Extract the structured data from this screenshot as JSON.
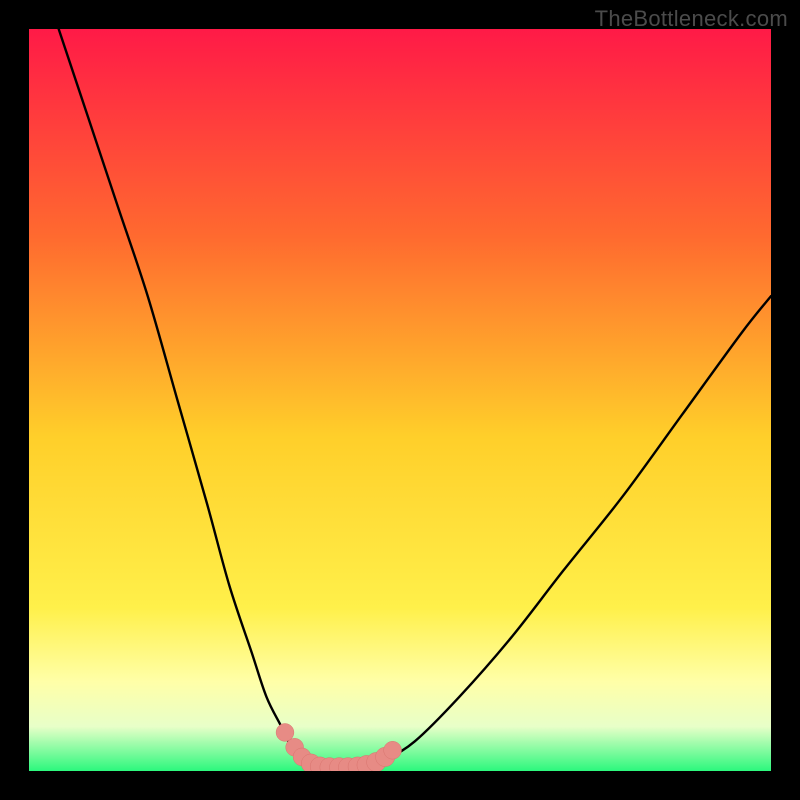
{
  "watermark": "TheBottleneck.com",
  "colors": {
    "frame": "#000000",
    "grad_top": "#ff1a47",
    "grad_mid1": "#ff8a2a",
    "grad_mid2": "#ffe92e",
    "grad_mid3": "#fffd8a",
    "grad_bottom": "#2cf87d",
    "curve": "#000000",
    "beads": "#e78b85",
    "bead_stroke": "#d9746e"
  },
  "chart_data": {
    "type": "line",
    "title": "",
    "xlabel": "",
    "ylabel": "",
    "xlim": [
      0,
      100
    ],
    "ylim": [
      0,
      100
    ],
    "grid": false,
    "note": "Axes are unlabeled; values are estimated proportions of plot width/height (0–100). y=100 at top, y=0 at bottom.",
    "series": [
      {
        "name": "curve",
        "x": [
          4,
          8,
          12,
          16,
          20,
          24,
          27,
          30,
          32,
          34,
          35.5,
          37,
          38.5,
          40,
          43,
          46,
          48,
          52,
          58,
          65,
          72,
          80,
          88,
          96,
          100
        ],
        "y": [
          100,
          88,
          76,
          64,
          50,
          36,
          25,
          16,
          10,
          6,
          3,
          1.5,
          0.8,
          0.5,
          0.5,
          0.8,
          1.5,
          4,
          10,
          18,
          27,
          37,
          48,
          59,
          64
        ]
      }
    ],
    "beads": {
      "note": "Salmon-colored points near trough of curve",
      "points": [
        {
          "x": 34.5,
          "y": 5.2,
          "r": 1.2
        },
        {
          "x": 35.8,
          "y": 3.2,
          "r": 1.2
        },
        {
          "x": 36.8,
          "y": 1.9,
          "r": 1.2
        },
        {
          "x": 38.0,
          "y": 1.0,
          "r": 1.3
        },
        {
          "x": 39.2,
          "y": 0.6,
          "r": 1.3
        },
        {
          "x": 40.5,
          "y": 0.5,
          "r": 1.3
        },
        {
          "x": 41.8,
          "y": 0.5,
          "r": 1.3
        },
        {
          "x": 43.0,
          "y": 0.5,
          "r": 1.3
        },
        {
          "x": 44.3,
          "y": 0.6,
          "r": 1.3
        },
        {
          "x": 45.5,
          "y": 0.8,
          "r": 1.3
        },
        {
          "x": 46.8,
          "y": 1.2,
          "r": 1.3
        },
        {
          "x": 48.0,
          "y": 1.9,
          "r": 1.3
        },
        {
          "x": 49.0,
          "y": 2.8,
          "r": 1.2
        }
      ]
    }
  }
}
